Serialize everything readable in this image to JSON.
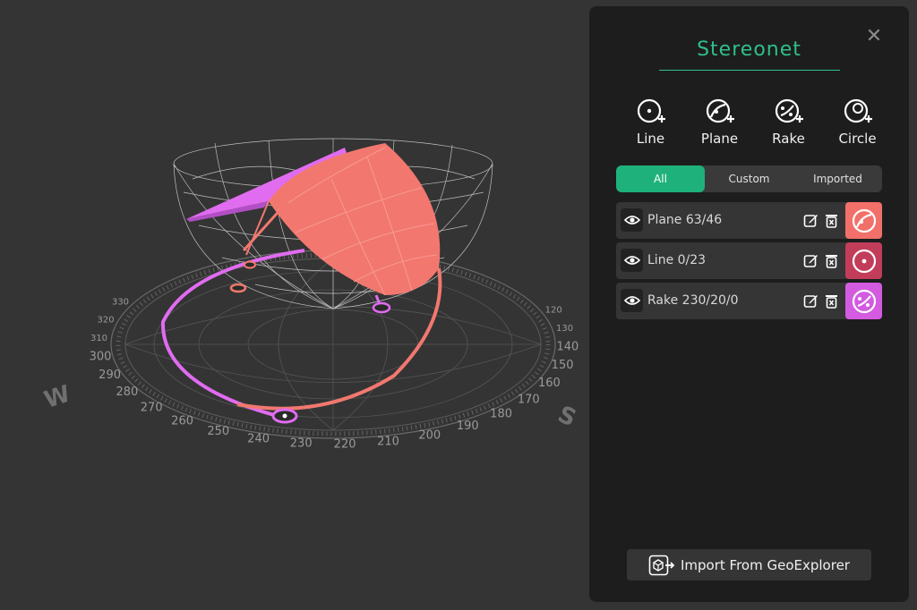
{
  "viewport": {
    "compass": {
      "west": "W",
      "south": "S"
    },
    "degree_labels": [
      "120",
      "130",
      "140",
      "150",
      "160",
      "170",
      "180",
      "190",
      "200",
      "210",
      "220",
      "230",
      "240",
      "250",
      "260",
      "270",
      "280",
      "290",
      "300",
      "310",
      "320",
      "330"
    ]
  },
  "panel": {
    "title": "Stereonet",
    "close_icon": "close-icon",
    "tools": [
      {
        "label": "Line",
        "icon": "line-add-icon"
      },
      {
        "label": "Plane",
        "icon": "plane-add-icon"
      },
      {
        "label": "Rake",
        "icon": "rake-add-icon"
      },
      {
        "label": "Circle",
        "icon": "circle-add-icon"
      }
    ],
    "tabs": [
      {
        "label": "All",
        "active": true
      },
      {
        "label": "Custom",
        "active": false
      },
      {
        "label": "Imported",
        "active": false
      }
    ],
    "items": [
      {
        "label": "Plane 63/46",
        "color": "#f2706a",
        "icon": "plane-icon"
      },
      {
        "label": "Line 0/23",
        "color": "#c23d5a",
        "icon": "line-icon"
      },
      {
        "label": "Rake 230/20/0",
        "color": "#d35be0",
        "icon": "rake-icon"
      }
    ],
    "import_label": "Import From GeoExplorer"
  },
  "colors": {
    "accent": "#1fb17c",
    "plane": "#f2706a",
    "line": "#c23d5a",
    "rake": "#d35be0",
    "panel_bg": "#1d1d1d",
    "viewport_bg": "#343434"
  }
}
